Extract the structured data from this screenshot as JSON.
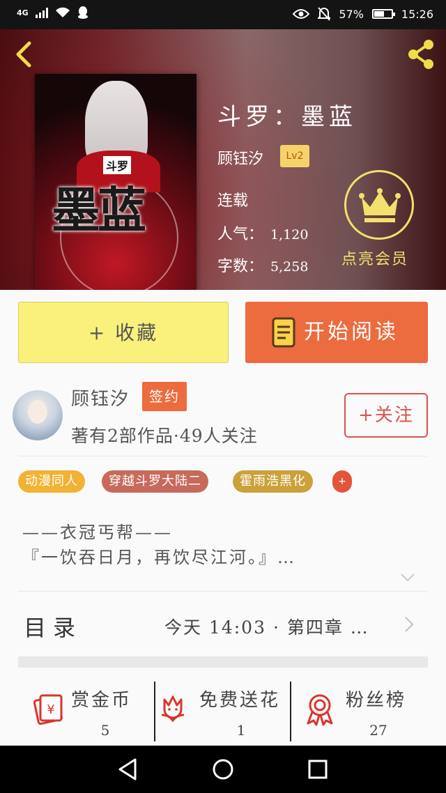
{
  "status_bar": {
    "network": "4G",
    "battery": "57%",
    "battery_level": 0.57,
    "time": "15:26"
  },
  "header": {
    "book_title": "斗罗：墨蓝",
    "cover_small_title": "斗罗",
    "cover_big_title": "墨蓝",
    "author": "顾钰汐",
    "level_badge": "Lv2",
    "status": "连载",
    "popularity_label": "人气：",
    "popularity_value": "1,120",
    "word_count_label": "字数：",
    "word_count_value": "5,258",
    "vip_label": "点亮会员"
  },
  "actions": {
    "collect_label": "+ 收藏",
    "read_label": "开始阅读"
  },
  "author_card": {
    "name": "顾钰汐",
    "badge": "签约",
    "stats": "著有2部作品·49人关注",
    "follow_label": "+关注"
  },
  "tags": [
    {
      "label": "动漫同人",
      "color": "#f2b234"
    },
    {
      "label": "穿越斗罗大陆二",
      "color": "#c76a5c"
    },
    {
      "label": "霍雨浩黑化",
      "color": "#caa13a"
    }
  ],
  "tag_add": "+",
  "description": {
    "line1": "——衣冠丐帮——",
    "line2": "『一饮吞日月，再饮尽江河。』…"
  },
  "toc": {
    "label": "目录",
    "latest": "今天 14:03 · 第四章 …"
  },
  "bottom_actions": [
    {
      "label": "赏金币",
      "value": "5",
      "icon": "red-envelope-icon"
    },
    {
      "label": "免费送花",
      "value": "1",
      "icon": "flower-icon"
    },
    {
      "label": "粉丝榜",
      "value": "27",
      "icon": "award-ribbon-icon"
    }
  ],
  "colors": {
    "accent_orange": "#ec6b3f",
    "collect_yellow": "#faf17d",
    "vip_gold": "#f3e06e",
    "icon_red": "#d9352b"
  }
}
